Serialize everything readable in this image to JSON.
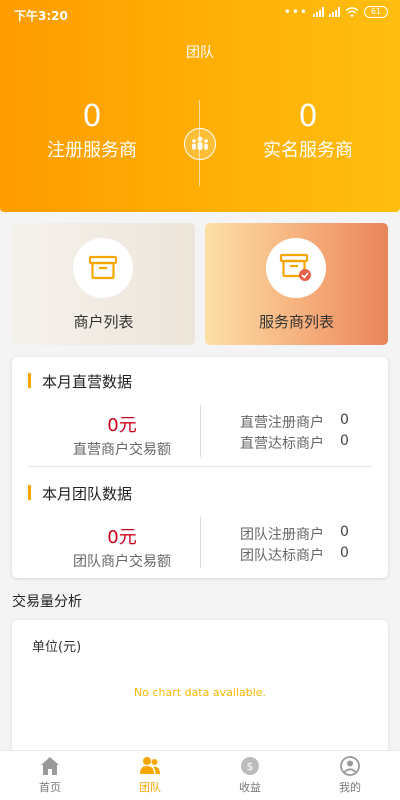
{
  "status": {
    "time": "下午3:20",
    "battery": "61"
  },
  "header": {
    "title": "团队"
  },
  "stats": {
    "registered": {
      "value": "0",
      "label": "注册服务商"
    },
    "verified": {
      "value": "0",
      "label": "实名服务商"
    }
  },
  "tiles": [
    {
      "label": "商户列表"
    },
    {
      "label": "服务商列表"
    }
  ],
  "direct": {
    "title": "本月直营数据",
    "amount": "0元",
    "amount_label": "直营商户交易额",
    "rows": [
      {
        "label": "直营注册商户",
        "value": "0"
      },
      {
        "label": "直营达标商户",
        "value": "0"
      }
    ]
  },
  "team": {
    "title": "本月团队数据",
    "amount": "0元",
    "amount_label": "团队商户交易额",
    "rows": [
      {
        "label": "团队注册商户",
        "value": "0"
      },
      {
        "label": "团队达标商户",
        "value": "0"
      }
    ]
  },
  "analysis": {
    "title": "交易量分析",
    "unit": "单位(元)",
    "empty_text": "No chart data available."
  },
  "tabbar": [
    {
      "label": "首页",
      "icon": "home-icon"
    },
    {
      "label": "团队",
      "icon": "team-icon"
    },
    {
      "label": "收益",
      "icon": "earnings-icon"
    },
    {
      "label": "我的",
      "icon": "profile-icon"
    }
  ],
  "colors": {
    "accent": "#f5a600",
    "amount": "#d0021b",
    "hero_start": "#ff9c00",
    "hero_end": "#ffbe10"
  }
}
